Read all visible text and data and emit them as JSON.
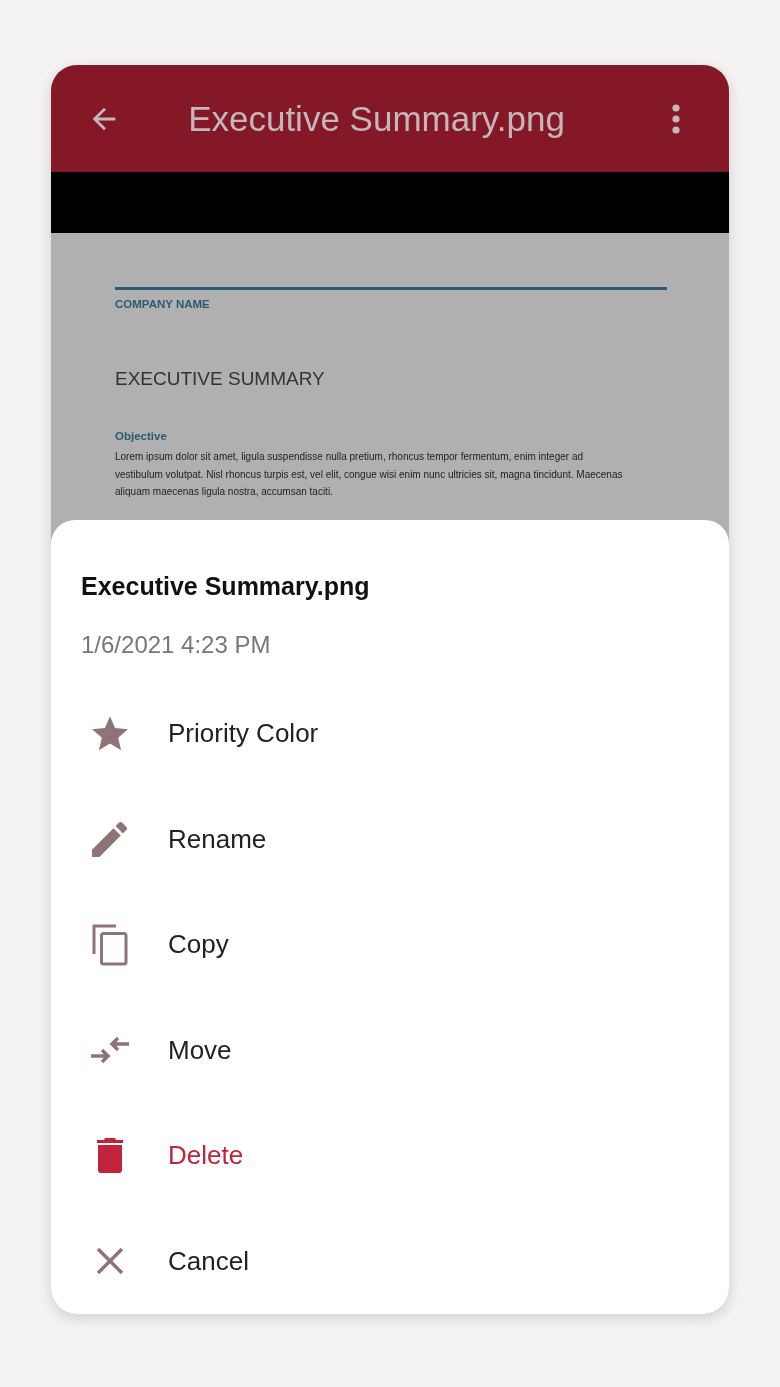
{
  "app_bar": {
    "title": "Executive Summary.png"
  },
  "document": {
    "company": "COMPANY NAME",
    "heading": "EXECUTIVE SUMMARY",
    "section": "Objective",
    "body": "Lorem ipsum dolor sit amet, ligula suspendisse nulla pretium, rhoncus tempor fermentum, enim integer ad vestibulum volutpat. Nisl rhoncus turpis est, vel elit, congue wisi enim nunc ultricies sit, magna tincidunt. Maecenas aliquam maecenas ligula nostra, accumsan taciti."
  },
  "sheet": {
    "title": "Executive Summary.png",
    "date": "1/6/2021 4:23 PM",
    "items": [
      {
        "kind": "star",
        "label": "Priority Color",
        "destructive": false
      },
      {
        "kind": "edit",
        "label": "Rename",
        "destructive": false
      },
      {
        "kind": "copy",
        "label": "Copy",
        "destructive": false
      },
      {
        "kind": "move",
        "label": "Move",
        "destructive": false
      },
      {
        "kind": "delete",
        "label": "Delete",
        "destructive": true
      },
      {
        "kind": "cancel",
        "label": "Cancel",
        "destructive": false
      }
    ]
  }
}
